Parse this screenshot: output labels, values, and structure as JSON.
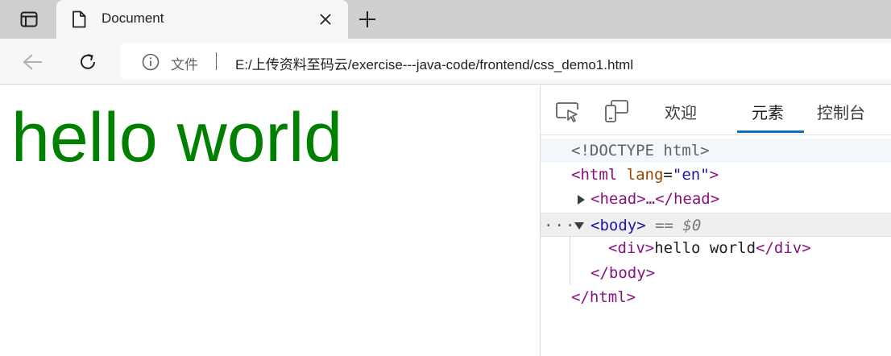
{
  "tab": {
    "title": "Document"
  },
  "address": {
    "site_label": "文件",
    "url": "E:/上传资料至码云/exercise---java-code/frontend/css_demo1.html"
  },
  "page": {
    "text": "hello world",
    "text_color": "#008000"
  },
  "devtools": {
    "tabs": [
      {
        "label": "欢迎"
      },
      {
        "label": "元素"
      },
      {
        "label": "控制台"
      }
    ],
    "active_tab": "元素",
    "accent_color": "#0f6cbd",
    "tree": {
      "doctype": "<!DOCTYPE html>",
      "html_open_tag": "<html",
      "html_attr_name": "lang",
      "html_attr_eq": "=",
      "html_attr_value": "\"en\"",
      "html_open_end": ">",
      "head": "<head>…</head>",
      "body_open": "<body>",
      "selected_marker": "== $0",
      "div_open": "<div>",
      "div_text": "hello world",
      "div_close": "</div>",
      "body_close": "</body>",
      "html_close": "</html>",
      "dots": "···"
    }
  },
  "icons": {
    "tab_actions": "tab-actions-icon",
    "page": "page-icon",
    "close": "close-icon",
    "new_tab": "plus-icon",
    "back": "back-arrow-icon",
    "reload": "reload-icon",
    "info": "info-icon",
    "inspect": "inspect-icon",
    "device": "device-emulation-icon"
  }
}
